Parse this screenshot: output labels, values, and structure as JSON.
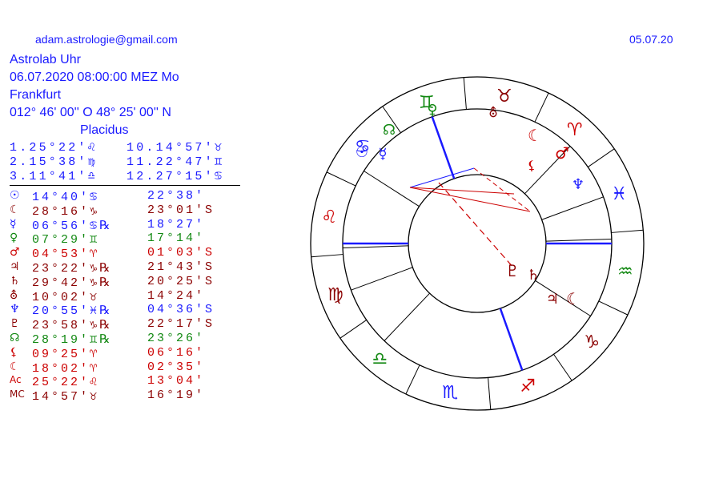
{
  "header": {
    "email": "adam.astrologie@gmail.com",
    "date_short": "05.07.20",
    "title": "Astrolab Uhr",
    "datetime": "06.07.2020  08:00:00  MEZ Mo",
    "city": "Frankfurt",
    "coords": "012° 46' 00'' O   48° 25' 00'' N",
    "house_system": "Placidus"
  },
  "houses": [
    {
      "left": "1.25°22′♌",
      "right": "10.14°57′♉"
    },
    {
      "left": "2.15°38′♍",
      "right": "11.22°47′♊"
    },
    {
      "left": "3.11°41′♎",
      "right": "12.27°15′♋"
    }
  ],
  "planets": [
    {
      "symbol": "☉",
      "name": "Sun",
      "position": "14°40′♋",
      "speed": "22°38′",
      "color": "#1a1aff"
    },
    {
      "symbol": "☾",
      "name": "Moon",
      "position": "28°16′♑",
      "speed": "23°01′S",
      "color": "#8b0000"
    },
    {
      "symbol": "☿",
      "name": "Mercury",
      "position": "06°56′♋℞",
      "speed": "18°27′",
      "color": "#1a1aff"
    },
    {
      "symbol": "♀",
      "name": "Venus",
      "position": "07°29′♊",
      "speed": "17°14′",
      "color": "#118811"
    },
    {
      "symbol": "♂",
      "name": "Mars",
      "position": "04°53′♈",
      "speed": "01°03′S",
      "color": "#cc0000"
    },
    {
      "symbol": "♃",
      "name": "Jupiter",
      "position": "23°22′♑℞",
      "speed": "21°43′S",
      "color": "#8b0000"
    },
    {
      "symbol": "♄",
      "name": "Saturn",
      "position": "29°42′♑℞",
      "speed": "20°25′S",
      "color": "#8b0000"
    },
    {
      "symbol": "⛢",
      "name": "Uranus",
      "position": "10°02′♉",
      "speed": "14°24′",
      "color": "#8b0000"
    },
    {
      "symbol": "♆",
      "name": "Neptune",
      "position": "20°55′♓℞",
      "speed": "04°36′S",
      "color": "#1a1aff"
    },
    {
      "symbol": "♇",
      "name": "Pluto",
      "position": "23°58′♑℞",
      "speed": "22°17′S",
      "color": "#8b0000"
    },
    {
      "symbol": "☊",
      "name": "Node",
      "position": "28°19′♊℞",
      "speed": "23°26′",
      "color": "#118811"
    },
    {
      "symbol": "⚸",
      "name": "Lilith",
      "position": "09°25′♈",
      "speed": "06°16′",
      "color": "#cc0000"
    },
    {
      "symbol": "☾",
      "name": "Moon2",
      "position": "18°02′♈",
      "speed": "02°35′",
      "color": "#cc0000"
    },
    {
      "symbol": "Ac",
      "name": "Ascendant",
      "position": "25°22′♌",
      "speed": "13°04′",
      "color": "#cc0000"
    },
    {
      "symbol": "MC",
      "name": "Midheaven",
      "position": "14°57′♉",
      "speed": "16°19′",
      "color": "#8b0000"
    }
  ],
  "wheel": {
    "signs": [
      {
        "glyph": "♉",
        "color": "#8b0000"
      },
      {
        "glyph": "♈",
        "color": "#cc0000"
      },
      {
        "glyph": "♓",
        "color": "#1a1aff"
      },
      {
        "glyph": "♒",
        "color": "#118811"
      },
      {
        "glyph": "♑",
        "color": "#8b0000"
      },
      {
        "glyph": "♐",
        "color": "#cc0000"
      },
      {
        "glyph": "♏",
        "color": "#1a1aff"
      },
      {
        "glyph": "♎",
        "color": "#118811"
      },
      {
        "glyph": "♍",
        "color": "#8b0000"
      },
      {
        "glyph": "♌",
        "color": "#cc0000"
      },
      {
        "glyph": "♋",
        "color": "#1a1aff"
      },
      {
        "glyph": "♊",
        "color": "#118811"
      }
    ],
    "planet_glyphs": [
      {
        "glyph": "♀",
        "color": "#118811"
      },
      {
        "glyph": "☊",
        "color": "#118811"
      },
      {
        "glyph": "☉",
        "color": "#1a1aff"
      },
      {
        "glyph": "☿",
        "color": "#1a1aff"
      },
      {
        "glyph": "⛢",
        "color": "#8b0000"
      },
      {
        "glyph": "☾",
        "color": "#cc0000"
      },
      {
        "glyph": "♂",
        "color": "#cc0000"
      },
      {
        "glyph": "⚸",
        "color": "#cc0000"
      },
      {
        "glyph": "♆",
        "color": "#1a1aff"
      },
      {
        "glyph": "♇",
        "color": "#8b0000"
      },
      {
        "glyph": "♄",
        "color": "#8b0000"
      },
      {
        "glyph": "♃",
        "color": "#8b0000"
      },
      {
        "glyph": "☾",
        "color": "#8b0000"
      }
    ]
  }
}
